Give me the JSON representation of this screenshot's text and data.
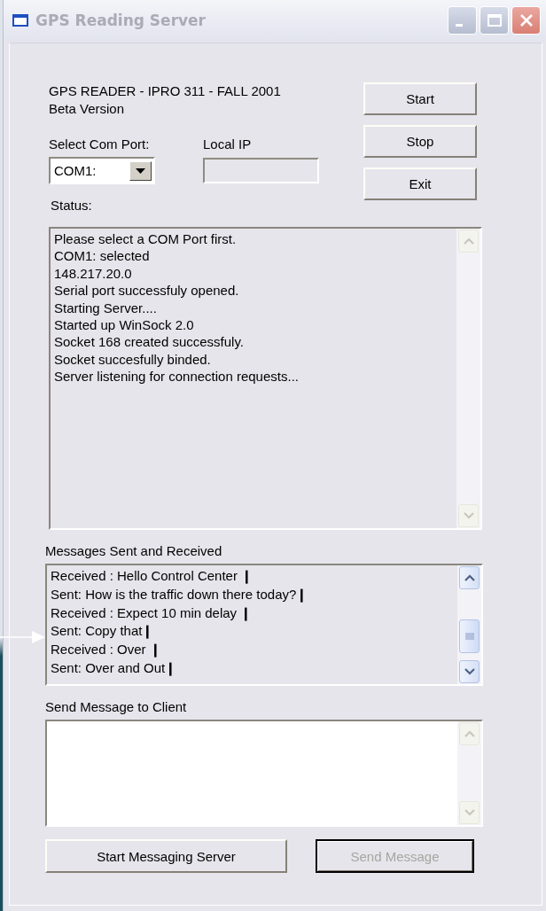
{
  "window": {
    "title": "GPS Reading Server",
    "active": false
  },
  "heading": "GPS READER - IPRO 311 - FALL 2001",
  "subheading": "Beta Version",
  "com_port": {
    "label": "Select Com Port:",
    "value": "COM1:"
  },
  "local_ip": {
    "label": "Local IP",
    "disabled": true
  },
  "buttons": [
    {
      "label": "Start"
    },
    {
      "label": "Stop"
    },
    {
      "label": "Exit"
    }
  ],
  "status": {
    "label": "Status:",
    "scroll_enabled": false,
    "lines": [
      "Please select a COM Port first.",
      "COM1: selected",
      "148.217.20.0",
      "Serial port successfuly opened.",
      "Starting Server....",
      "Started up WinSock 2.0",
      "Socket 168 created successfuly.",
      "Socket succesfully binded.",
      "Server listening for connection requests..."
    ]
  },
  "messages": {
    "label": "Messages Sent and Received",
    "scroll_enabled": true,
    "lines": [
      "Received : Hello Control Center ❙",
      "Sent: How is the traffic down there today?❙",
      "Received : Expect 10 min delay ❙",
      "Sent: Copy that❙",
      "Received : Over ❙",
      "Sent: Over and Out❙"
    ]
  },
  "send": {
    "label": "Send Message to Client",
    "scroll_enabled": false
  },
  "actions": [
    {
      "label": "Start Messaging Server",
      "disabled": false,
      "default": false
    },
    {
      "label": "Send Message",
      "disabled": true,
      "default": true
    }
  ]
}
